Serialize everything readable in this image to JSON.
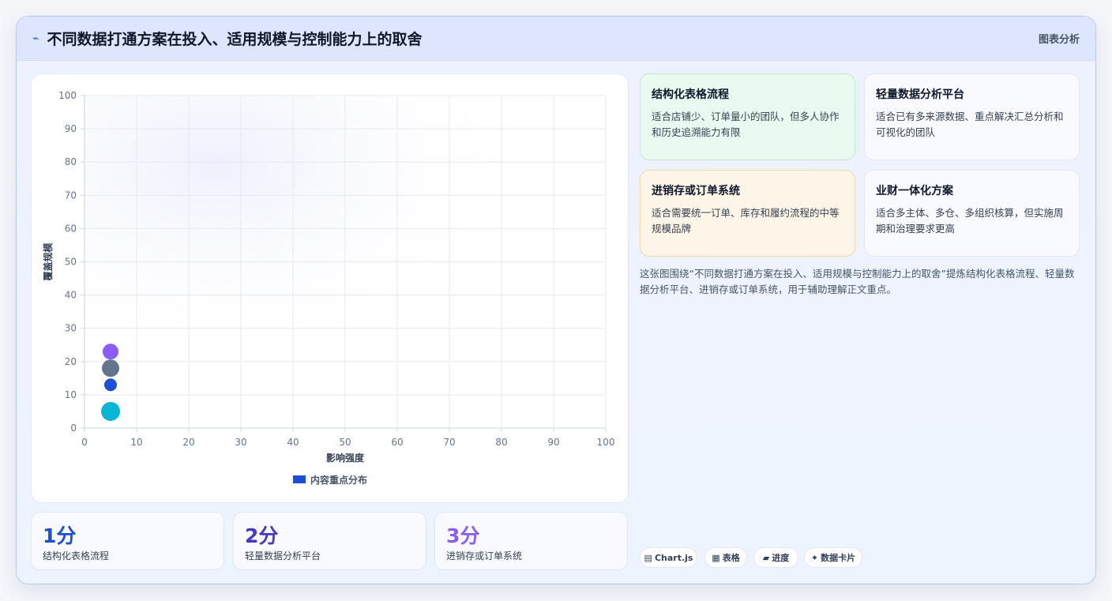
{
  "header": {
    "title": "不同数据打通方案在投入、适用规模与控制能力上的取舍",
    "icon": "lightning-icon",
    "right_label": "图表分析"
  },
  "chart_data": {
    "type": "scatter",
    "xlabel": "影响强度",
    "ylabel": "覆盖规模",
    "xlim": [
      0,
      100
    ],
    "ylim": [
      0,
      100
    ],
    "xticks": [
      0,
      10,
      20,
      30,
      40,
      50,
      60,
      70,
      80,
      90,
      100
    ],
    "yticks": [
      0,
      10,
      20,
      30,
      40,
      50,
      60,
      70,
      80,
      90,
      100
    ],
    "grid": true,
    "legend": "bottom",
    "legend_label": "内容重点分布",
    "legend_color": "#1d4ed8",
    "points": [
      {
        "x": 5,
        "y": 23,
        "r": 10,
        "color": "#8b5cf6"
      },
      {
        "x": 5,
        "y": 18,
        "r": 11,
        "color": "#64748b"
      },
      {
        "x": 5,
        "y": 13,
        "r": 8,
        "color": "#1d4ed8"
      },
      {
        "x": 5,
        "y": 5,
        "r": 12,
        "color": "#06b6d4"
      }
    ]
  },
  "stats": [
    {
      "value": "1分",
      "label": "结构化表格流程",
      "color": "#1d4ed8"
    },
    {
      "value": "2分",
      "label": "轻量数据分析平台",
      "color": "#4338ca"
    },
    {
      "value": "3分",
      "label": "进销存或订单系统",
      "color": "#8b5cf6"
    }
  ],
  "cards": [
    {
      "title": "结构化表格流程",
      "desc": "适合店铺少、订单量小的团队，但多人协作和历史追溯能力有限"
    },
    {
      "title": "轻量数据分析平台",
      "desc": "适合已有多来源数据、重点解决汇总分析和可视化的团队"
    },
    {
      "title": "进销存或订单系统",
      "desc": "适合需要统一订单、库存和履约流程的中等规模品牌"
    },
    {
      "title": "业财一体化方案",
      "desc": "适合多主体、多仓、多组织核算，但实施周期和治理要求更高"
    }
  ],
  "description": "这张图围绕“不同数据打通方案在投入、适用规模与控制能力上的取舍”提炼结构化表格流程、轻量数据分析平台、进销存或订单系统，用于辅助理解正文重点。",
  "chips": [
    {
      "icon": "chart-icon",
      "glyph": "▤",
      "label": "Chart.js"
    },
    {
      "icon": "table-icon",
      "glyph": "▦",
      "label": "表格"
    },
    {
      "icon": "progress-icon",
      "glyph": "▰",
      "label": "进度"
    },
    {
      "icon": "sparkle-icon",
      "glyph": "✦",
      "label": "数据卡片"
    }
  ]
}
